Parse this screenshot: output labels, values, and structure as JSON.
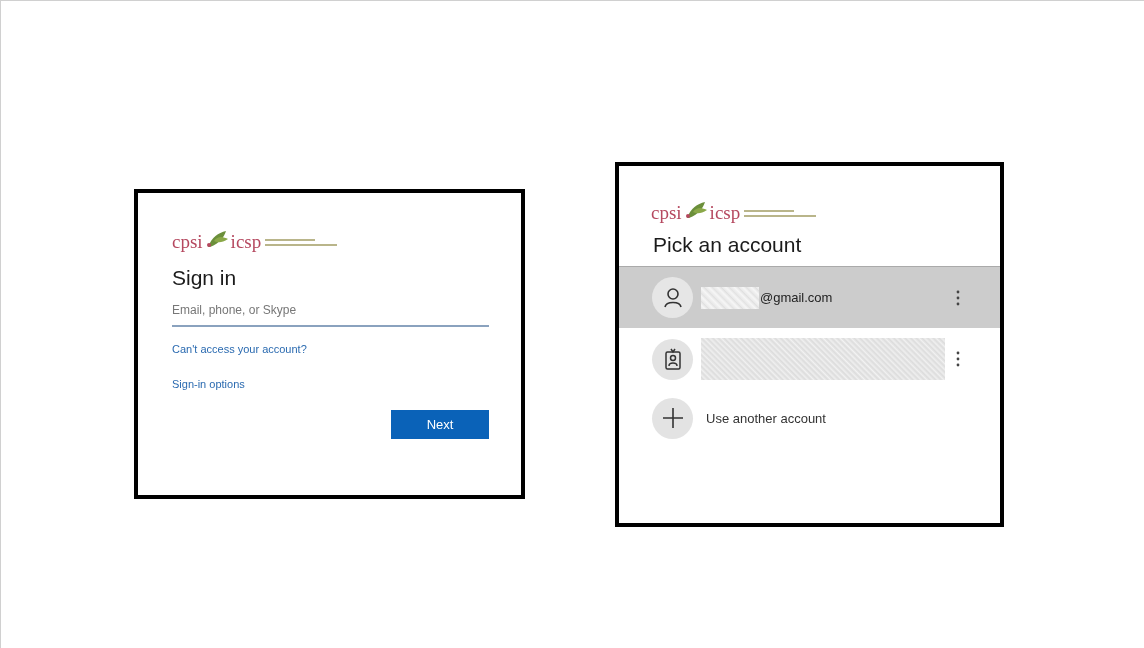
{
  "sign_in": {
    "logo": {
      "left": "cpsi",
      "right": "icsp"
    },
    "title": "Sign in",
    "email_field": {
      "placeholder": "Email, phone, or Skype"
    },
    "links": [
      "Can't access your account?",
      "Sign-in options"
    ],
    "next_button": "Next"
  },
  "account_picker": {
    "logo": {
      "left": "cpsi",
      "right": "icsp"
    },
    "title": "Pick an account",
    "accounts": [
      {
        "kind": "personal",
        "email": "@gmail.com",
        "selected": true
      },
      {
        "kind": "work",
        "selected": false
      }
    ],
    "use_another": "Use another account"
  }
}
